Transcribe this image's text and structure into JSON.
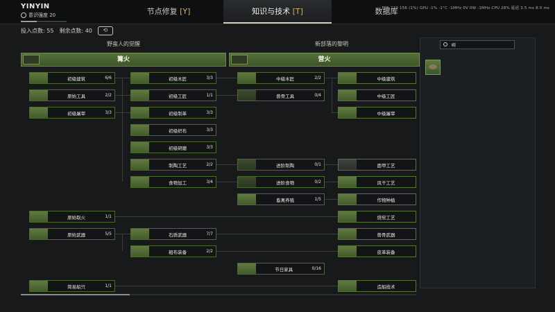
{
  "player": {
    "name": "YINYIN",
    "level_label": "意识强度 20",
    "xp_fraction": 0.35
  },
  "tabs": [
    {
      "label": "节点修复 ",
      "hotkey": "[Y]",
      "active": false
    },
    {
      "label": "知识与技术 ",
      "hotkey": "[T]",
      "active": true
    },
    {
      "label": "数据库",
      "hotkey": "",
      "active": false
    }
  ],
  "perf": "FPS 229 156 (1%) GPU -1% -1°C -1MHz 0V 0W -1MHz CPU 28% 延迟 3.5 ms 8.0 ms",
  "points": {
    "invested_label": "投入点数:",
    "invested": "55",
    "remaining_label": "剩余点数:",
    "remaining": "40",
    "reset_icon": "⟲"
  },
  "eras": [
    {
      "title": "野蛮人的觉醒",
      "header": "篝火"
    },
    {
      "title": "新部落的黎明",
      "header": "营火"
    }
  ],
  "nodes_col1": [
    {
      "label": "初级建筑",
      "count": "6/6"
    },
    {
      "label": "原始工具",
      "count": "2/2"
    },
    {
      "label": "初级屠宰",
      "count": "3/3"
    },
    {
      "label": "原始取火",
      "count": "1/1"
    },
    {
      "label": "原始武器",
      "count": "5/5"
    },
    {
      "label": "简易船只",
      "count": "1/1"
    }
  ],
  "nodes_col2": [
    {
      "label": "初级木匠",
      "count": "3/3"
    },
    {
      "label": "初级工匠",
      "count": "1/1"
    },
    {
      "label": "初级制革",
      "count": "3/3"
    },
    {
      "label": "初级织布",
      "count": "3/3"
    },
    {
      "label": "初级研磨",
      "count": "3/3"
    },
    {
      "label": "制陶工艺",
      "count": "2/2"
    },
    {
      "label": "食物加工",
      "count": "3/4"
    },
    {
      "label": "石质武器",
      "count": "7/7"
    },
    {
      "label": "粗布装备",
      "count": "2/2"
    }
  ],
  "nodes_col3": [
    {
      "label": "中级木匠",
      "count": "2/2"
    },
    {
      "label": "兽骨工具",
      "count": "0/4"
    },
    {
      "label": "进阶制陶",
      "count": "0/1"
    },
    {
      "label": "进阶食物",
      "count": "0/2"
    },
    {
      "label": "畜禽养殖",
      "count": "1/5"
    },
    {
      "label": "节日家具",
      "count": "0/16"
    }
  ],
  "nodes_col4": [
    {
      "label": "中级建筑",
      "count": ""
    },
    {
      "label": "中级工匠",
      "count": ""
    },
    {
      "label": "中级屠宰",
      "count": ""
    },
    {
      "label": "面甲工艺",
      "count": ""
    },
    {
      "label": "风干工艺",
      "count": ""
    },
    {
      "label": "作物种植",
      "count": ""
    },
    {
      "label": "烧窑工艺",
      "count": ""
    },
    {
      "label": "兽骨武器",
      "count": ""
    },
    {
      "label": "皮革装备",
      "count": ""
    },
    {
      "label": "造船技术",
      "count": ""
    }
  ],
  "search": {
    "placeholder": "",
    "value": "碗"
  },
  "colors": {
    "accent_green": "#4e6b33",
    "tab_hotkey": "#d6b36a",
    "background": "#17191b"
  }
}
